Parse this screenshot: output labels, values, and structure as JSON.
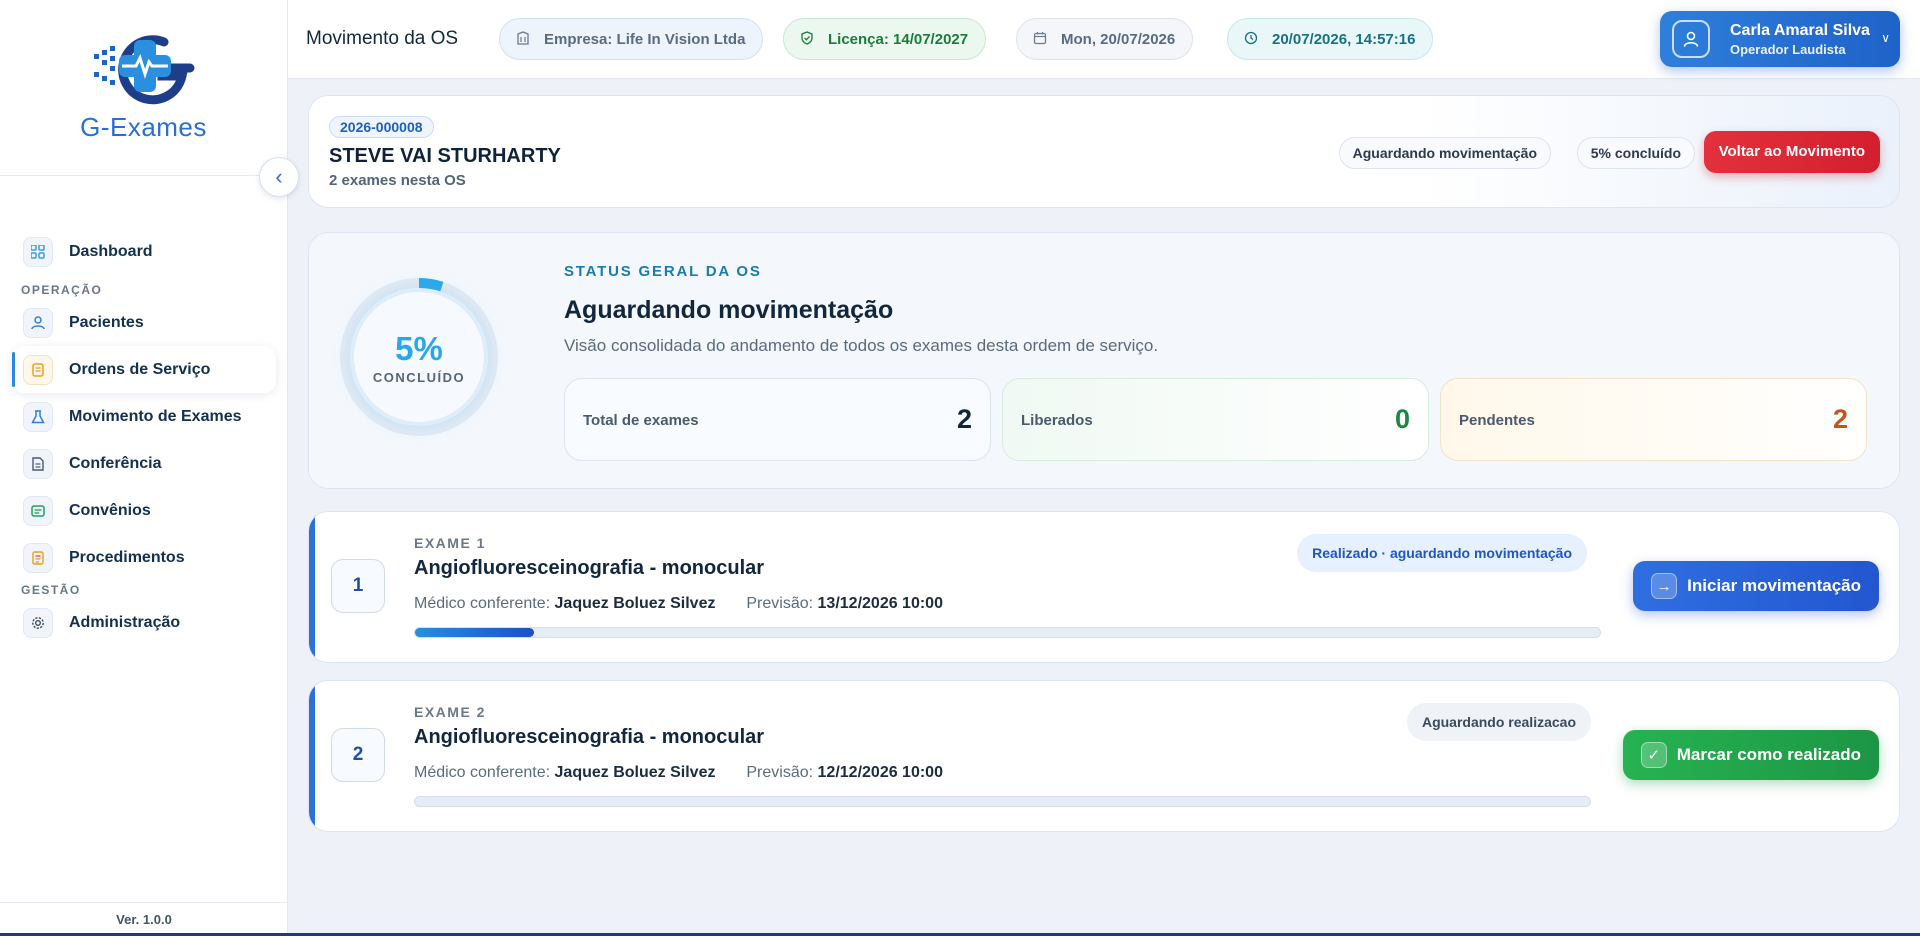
{
  "app": {
    "logo_text": "G-Exames",
    "version": "Ver. 1.0.0"
  },
  "sidebar": {
    "items": [
      {
        "label": "Dashboard",
        "icon": "grid-icon"
      },
      {
        "section": "OPERAÇÃO"
      },
      {
        "label": "Pacientes",
        "icon": "user-icon"
      },
      {
        "label": "Ordens de Serviço",
        "icon": "document-icon",
        "active": true
      },
      {
        "label": "Movimento de Exames",
        "icon": "flask-icon"
      },
      {
        "label": "Conferência",
        "icon": "file-text-icon"
      },
      {
        "label": "Convênios",
        "icon": "id-card-icon"
      },
      {
        "label": "Procedimentos",
        "icon": "list-icon"
      },
      {
        "section": "GESTÃO"
      },
      {
        "label": "Administração",
        "icon": "gear-icon"
      }
    ]
  },
  "topbar": {
    "title": "Movimento da OS",
    "company": "Empresa: Life In Vision Ltda",
    "license": "Licença: 14/07/2027",
    "date": "Mon, 20/07/2026",
    "datetime": "20/07/2026, 14:57:16",
    "user_name": "Carla Amaral Silva",
    "user_role": "Operador Laudista"
  },
  "os": {
    "code": "2026-000008",
    "patient": "STEVE VAI STURHARTY",
    "subtitle": "2 exames nesta OS",
    "status_pill": "Aguardando movimentação",
    "pct_pill": "5% concluído",
    "back_button": "Voltar ao Movimento"
  },
  "status": {
    "percent_text": "5%",
    "percent_value": 0.05,
    "percent_label": "CONCLUÍDO",
    "eyebrow": "STATUS GERAL DA OS",
    "title": "Aguardando movimentação",
    "description": "Visão consolidada do andamento de todos os exames desta ordem de serviço.",
    "kpis": {
      "total_label": "Total de exames",
      "total_value": "2",
      "lib_label": "Liberados",
      "lib_value": "0",
      "pend_label": "Pendentes",
      "pend_value": "2"
    }
  },
  "exams": [
    {
      "number": "1",
      "eyebrow": "EXAME 1",
      "name": "Angiofluoresceinografia - monocular",
      "doctor_label": "Médico conferente:",
      "doctor": "Jaquez Boluez Silvez",
      "forecast_label": "Previsão:",
      "forecast": "13/12/2026 10:00",
      "badge": "Realizado · aguardando movimentação",
      "button": "Iniciar movimentação",
      "progress": 0.1
    },
    {
      "number": "2",
      "eyebrow": "EXAME 2",
      "name": "Angiofluoresceinografia - monocular",
      "doctor_label": "Médico conferente:",
      "doctor": "Jaquez Boluez Silvez",
      "forecast_label": "Previsão:",
      "forecast": "12/12/2026 10:00",
      "badge": "Aguardando realizacao",
      "button": "Marcar como realizado",
      "progress": 0
    }
  ],
  "colors": {
    "accent": "#2a6fd6",
    "success": "#1c9645",
    "danger": "#d41f2e",
    "ring": "#2aa7ec"
  }
}
